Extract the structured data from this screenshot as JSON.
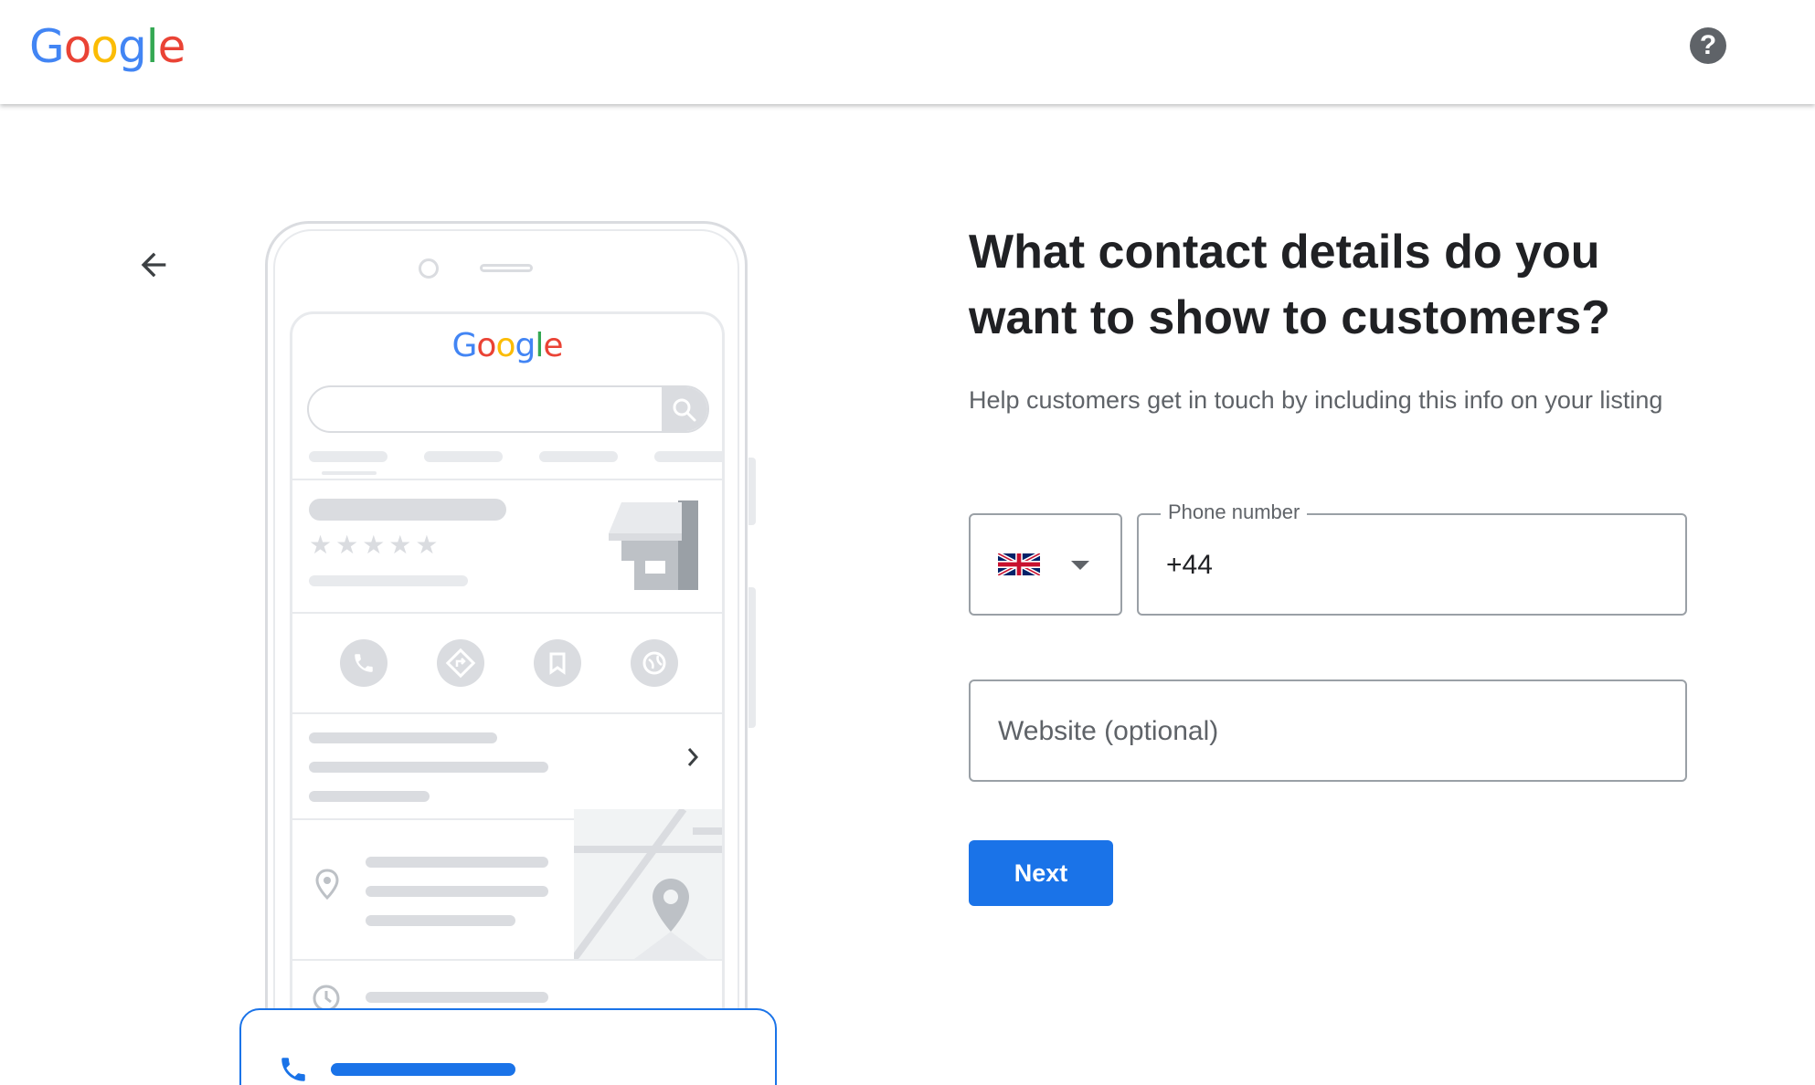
{
  "header": {
    "logo_letters": [
      "G",
      "o",
      "o",
      "g",
      "l",
      "e"
    ],
    "logo_colors": [
      "#4285F4",
      "#EA4335",
      "#FBBC05",
      "#4285F4",
      "#34A853",
      "#EA4335"
    ],
    "help_icon": "?"
  },
  "illustration": {
    "logo_text": "Google"
  },
  "form": {
    "title": "What contact details do you want to show to customers?",
    "subtitle": "Help customers get in touch by including this info on your listing",
    "country_flag": "uk-flag-icon",
    "phone_label": "Phone number",
    "phone_value": "+44",
    "website_placeholder": "Website (optional)",
    "next_label": "Next"
  },
  "colors": {
    "accent": "#1a73e8",
    "border": "#9aa0a6",
    "text_secondary": "#5f6368"
  }
}
